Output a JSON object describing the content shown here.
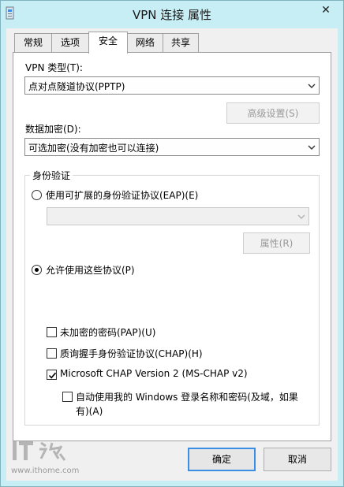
{
  "window": {
    "title": "VPN 连接 属性",
    "close_glyph": "✕"
  },
  "tabs": [
    {
      "label": "常规",
      "active": false
    },
    {
      "label": "选项",
      "active": false
    },
    {
      "label": "安全",
      "active": true
    },
    {
      "label": "网络",
      "active": false
    },
    {
      "label": "共享",
      "active": false
    }
  ],
  "security": {
    "vpn_type_label": "VPN 类型(T):",
    "vpn_type_value": "点对点隧道协议(PPTP)",
    "advanced_button": "高级设置(S)",
    "encryption_label": "数据加密(D):",
    "encryption_value": "可选加密(没有加密也可以连接)",
    "auth_group_label": "身份验证",
    "eap_radio_label": "使用可扩展的身份验证协议(EAP)(E)",
    "eap_radio_checked": false,
    "eap_combo_value": "",
    "properties_button": "属性(R)",
    "protocols_radio_label": "允许使用这些协议(P)",
    "protocols_radio_checked": true,
    "protocols": [
      {
        "label": "未加密的密码(PAP)(U)",
        "checked": false
      },
      {
        "label": "质询握手身份验证协议(CHAP)(H)",
        "checked": false
      },
      {
        "label": "Microsoft CHAP Version 2 (MS-CHAP v2)",
        "checked": true
      }
    ],
    "auto_login_label_line1": "自动使用我的 Windows 登录名称和密码(及域，如果",
    "auto_login_label_line2": "有)(A)",
    "auto_login_checked": false
  },
  "footer": {
    "ok_button": "确定",
    "cancel_button": "取消"
  },
  "watermark": {
    "url": "www.ithome.com"
  },
  "colors": {
    "frame": "#c7eef5",
    "default_button_border": "#3a8ee6"
  }
}
